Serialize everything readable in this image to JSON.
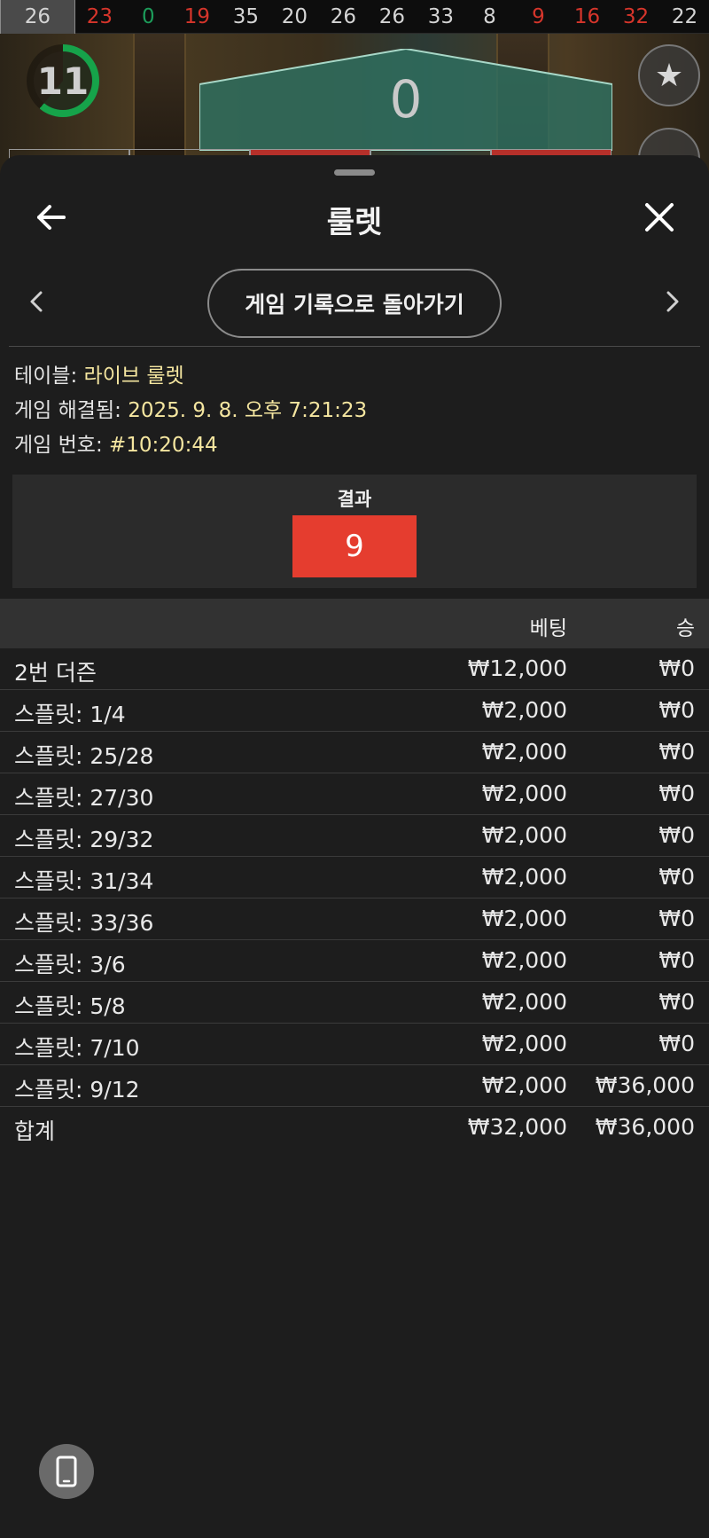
{
  "top_strip": {
    "numbers": [
      {
        "value": "26",
        "color": "black"
      },
      {
        "value": "23",
        "color": "red"
      },
      {
        "value": "0",
        "color": "green"
      },
      {
        "value": "19",
        "color": "red"
      },
      {
        "value": "35",
        "color": "black"
      },
      {
        "value": "20",
        "color": "black"
      },
      {
        "value": "26",
        "color": "black"
      },
      {
        "value": "26",
        "color": "black"
      },
      {
        "value": "33",
        "color": "black"
      },
      {
        "value": "8",
        "color": "black"
      },
      {
        "value": "9",
        "color": "red"
      },
      {
        "value": "16",
        "color": "red"
      },
      {
        "value": "32",
        "color": "red"
      },
      {
        "value": "22",
        "color": "black"
      }
    ]
  },
  "game": {
    "timer_value": "11",
    "timer_progress": 0.61,
    "current_number": "0",
    "favorite_icon": "star-icon"
  },
  "sheet": {
    "title": "룰렛",
    "back_icon": "arrow-left-icon",
    "close_icon": "close-icon",
    "prev_icon": "‹",
    "next_icon": "›",
    "return_button": "게임 기록으로 돌아가기",
    "info": {
      "table_label": "테이블:",
      "table_value": "라이브 룰렛",
      "resolved_label": "게임 해결됨:",
      "resolved_value": "2025. 9. 8. 오후 7:21:23",
      "number_label": "게임 번호:",
      "number_value": "#10:20:44"
    },
    "result": {
      "label": "결과",
      "value": "9",
      "color": "#e53d2f"
    },
    "table": {
      "headers": {
        "bet": "베팅",
        "win": "승"
      },
      "rows": [
        {
          "name": "2번 더즌",
          "bet": "₩12,000",
          "win": "₩0"
        },
        {
          "name": "스플릿: 1/4",
          "bet": "₩2,000",
          "win": "₩0"
        },
        {
          "name": "스플릿: 25/28",
          "bet": "₩2,000",
          "win": "₩0"
        },
        {
          "name": "스플릿: 27/30",
          "bet": "₩2,000",
          "win": "₩0"
        },
        {
          "name": "스플릿: 29/32",
          "bet": "₩2,000",
          "win": "₩0"
        },
        {
          "name": "스플릿: 31/34",
          "bet": "₩2,000",
          "win": "₩0"
        },
        {
          "name": "스플릿: 33/36",
          "bet": "₩2,000",
          "win": "₩0"
        },
        {
          "name": "스플릿: 3/6",
          "bet": "₩2,000",
          "win": "₩0"
        },
        {
          "name": "스플릿: 5/8",
          "bet": "₩2,000",
          "win": "₩0"
        },
        {
          "name": "스플릿: 7/10",
          "bet": "₩2,000",
          "win": "₩0"
        },
        {
          "name": "스플릿: 9/12",
          "bet": "₩2,000",
          "win": "₩36,000"
        }
      ],
      "total": {
        "name": "합계",
        "bet": "₩32,000",
        "win": "₩36,000"
      }
    },
    "device_icon": "mobile-phone-icon"
  }
}
